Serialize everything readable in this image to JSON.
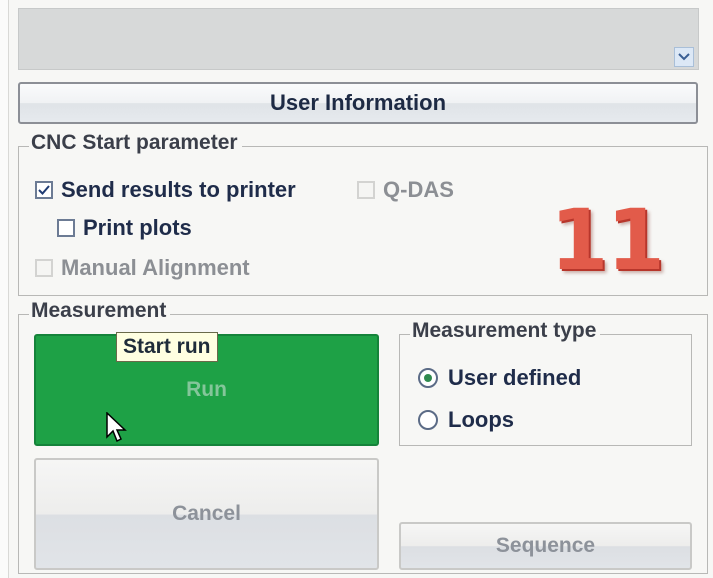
{
  "dropdown": {
    "value": "",
    "arrow_icon": "chevron-down-icon"
  },
  "user_info": {
    "label": "User Information"
  },
  "cnc": {
    "title": "CNC Start parameter",
    "send_results": {
      "label": "Send results to printer",
      "checked": true
    },
    "qdas": {
      "label": "Q-DAS",
      "checked": false,
      "enabled": false
    },
    "print_plots": {
      "label": "Print plots",
      "checked": false
    },
    "manual_alignment": {
      "label": "Manual Alignment",
      "checked": false,
      "enabled": false
    }
  },
  "annotation": {
    "number": "11",
    "color": "#e25b4a"
  },
  "measurement": {
    "title": "Measurement",
    "run_label": "Run",
    "run_color": "#1ea146",
    "tooltip": "Start run",
    "cancel_label": "Cancel",
    "sequence_label": "Sequence",
    "type": {
      "title": "Measurement type",
      "options": [
        {
          "label": "User defined",
          "selected": true
        },
        {
          "label": "Loops",
          "selected": false
        }
      ]
    }
  }
}
